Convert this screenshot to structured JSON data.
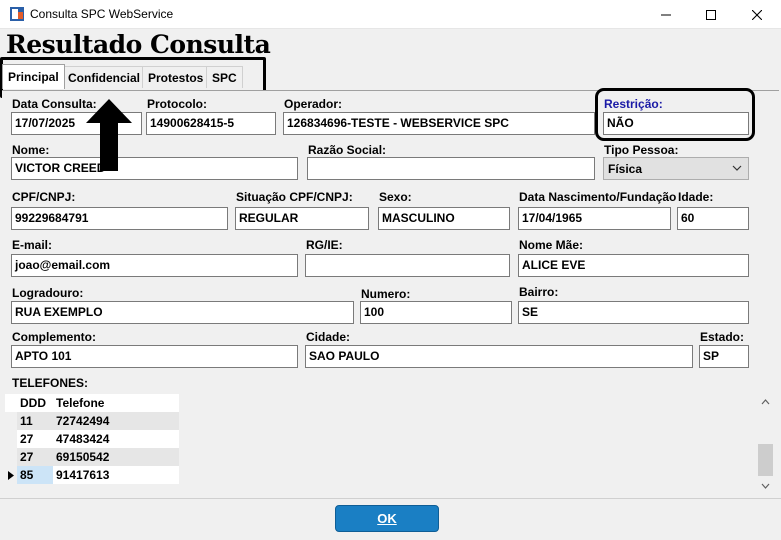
{
  "window": {
    "title": "Consulta SPC WebService"
  },
  "page_title": "Resultado Consulta",
  "tabs": [
    {
      "label": "Principal"
    },
    {
      "label": "Confidencial"
    },
    {
      "label": "Protestos"
    },
    {
      "label": "SPC"
    }
  ],
  "form": {
    "data_consulta": {
      "label": "Data Consulta:",
      "value": "17/07/2025"
    },
    "protocolo": {
      "label": "Protocolo:",
      "value": "14900628415-5"
    },
    "operador": {
      "label": "Operador:",
      "value": "126834696-TESTE - WEBSERVICE SPC"
    },
    "restricao": {
      "label": "Restrição:",
      "value": "NÃO"
    },
    "nome": {
      "label": "Nome:",
      "value": "VICTOR CREED"
    },
    "razao_social": {
      "label": "Razão Social:",
      "value": ""
    },
    "tipo_pessoa": {
      "label": "Tipo Pessoa:",
      "value": "Física"
    },
    "cpf_cnpj": {
      "label": "CPF/CNPJ:",
      "value": "99229684791"
    },
    "situacao": {
      "label": "Situação CPF/CNPJ:",
      "value": "REGULAR"
    },
    "sexo": {
      "label": "Sexo:",
      "value": "MASCULINO"
    },
    "data_nascimento": {
      "label": "Data Nascimento/Fundação",
      "value": "17/04/1965"
    },
    "idade": {
      "label": "Idade:",
      "value": "60"
    },
    "email": {
      "label": "E-mail:",
      "value": "joao@email.com"
    },
    "rg_ie": {
      "label": "RG/IE:",
      "value": ""
    },
    "nome_mae": {
      "label": "Nome Mãe:",
      "value": "ALICE EVE"
    },
    "logradouro": {
      "label": "Logradouro:",
      "value": "RUA EXEMPLO"
    },
    "numero": {
      "label": "Numero:",
      "value": "100"
    },
    "bairro": {
      "label": "Bairro:",
      "value": "SE"
    },
    "complemento": {
      "label": "Complemento:",
      "value": "APTO 101"
    },
    "cidade": {
      "label": "Cidade:",
      "value": "SAO PAULO"
    },
    "estado": {
      "label": "Estado:",
      "value": "SP"
    }
  },
  "telefones": {
    "label": "TELEFONES:",
    "columns": [
      "DDD",
      "Telefone"
    ],
    "rows": [
      {
        "ddd": "11",
        "telefone": "72742494"
      },
      {
        "ddd": "27",
        "telefone": "47483424"
      },
      {
        "ddd": "27",
        "telefone": "69150542"
      },
      {
        "ddd": "85",
        "telefone": "91417613"
      }
    ]
  },
  "ok_label": "OK",
  "colors": {
    "ok_button": "#1a7fc4",
    "restricao_label": "#1a1aa6"
  }
}
